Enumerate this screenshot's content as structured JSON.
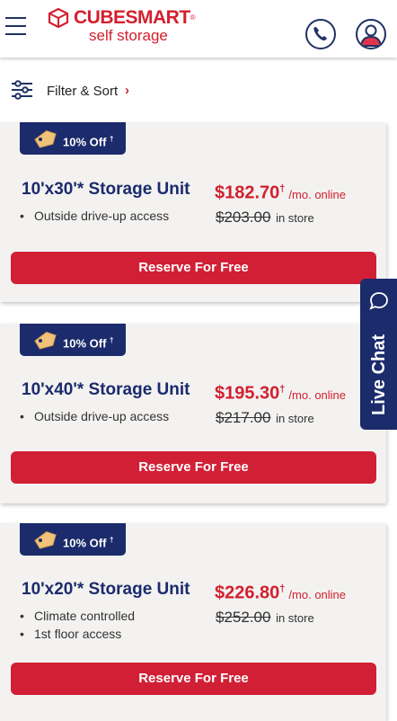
{
  "header": {
    "brand": "CUBESMART",
    "brand_tm": "®",
    "brand_sub": "self storage"
  },
  "icons": {
    "menu": "hamburger-icon",
    "phone": "phone-icon",
    "account": "account-icon",
    "filter": "sliders-icon",
    "tag": "price-tag-icon",
    "chat": "chat-bubble-icon"
  },
  "filter": {
    "label": "Filter & Sort",
    "chevron": "›"
  },
  "units": [
    {
      "badge": "10% Off",
      "badge_mark": "†",
      "title": "10'x30'* Storage Unit",
      "price": "$182.70",
      "price_mark": "†",
      "price_suffix": "/mo. online",
      "instore_price": "$203.00",
      "instore_label": "in store",
      "features": [
        "Outside drive-up access"
      ],
      "cta": "Reserve For Free"
    },
    {
      "badge": "10% Off",
      "badge_mark": "†",
      "title": "10'x40'* Storage Unit",
      "price": "$195.30",
      "price_mark": "†",
      "price_suffix": "/mo. online",
      "instore_price": "$217.00",
      "instore_label": "in store",
      "features": [
        "Outside drive-up access"
      ],
      "cta": "Reserve For Free"
    },
    {
      "badge": "10% Off",
      "badge_mark": "†",
      "title": "10'x20'* Storage Unit",
      "price": "$226.80",
      "price_mark": "†",
      "price_suffix": "/mo. online",
      "instore_price": "$252.00",
      "instore_label": "in store",
      "features": [
        "Climate controlled",
        "1st floor access"
      ],
      "cta": "Reserve For Free"
    }
  ],
  "live_chat": {
    "label": "Live Chat"
  },
  "colors": {
    "brand_red": "#d3202e",
    "navy": "#1b2b6b",
    "button_red": "#d11f35",
    "card_bg": "#f3f2f1"
  }
}
